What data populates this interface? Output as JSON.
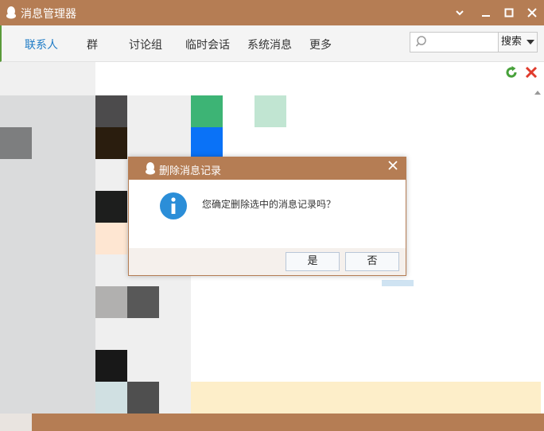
{
  "window": {
    "title": "消息管理器",
    "controls": {
      "menu": "▾",
      "minimize": "—",
      "maximize": "□",
      "close": "✕"
    }
  },
  "tabs": [
    "联系人",
    "群",
    "讨论组",
    "临时会话",
    "系统消息",
    "更多"
  ],
  "search": {
    "placeholder": "",
    "button_label": "搜索"
  },
  "dialog": {
    "title": "删除消息记录",
    "message": "您确定删除选中的消息记录吗？",
    "yes_label": "是",
    "no_label": "否"
  },
  "colors": {
    "brand": "#b57d54",
    "active_tab": "#1e7bc6",
    "info": "#2b8ed8"
  },
  "icons": [
    "qq-penguin-icon",
    "search-icon",
    "refresh-icon",
    "delete-icon",
    "info-icon"
  ]
}
